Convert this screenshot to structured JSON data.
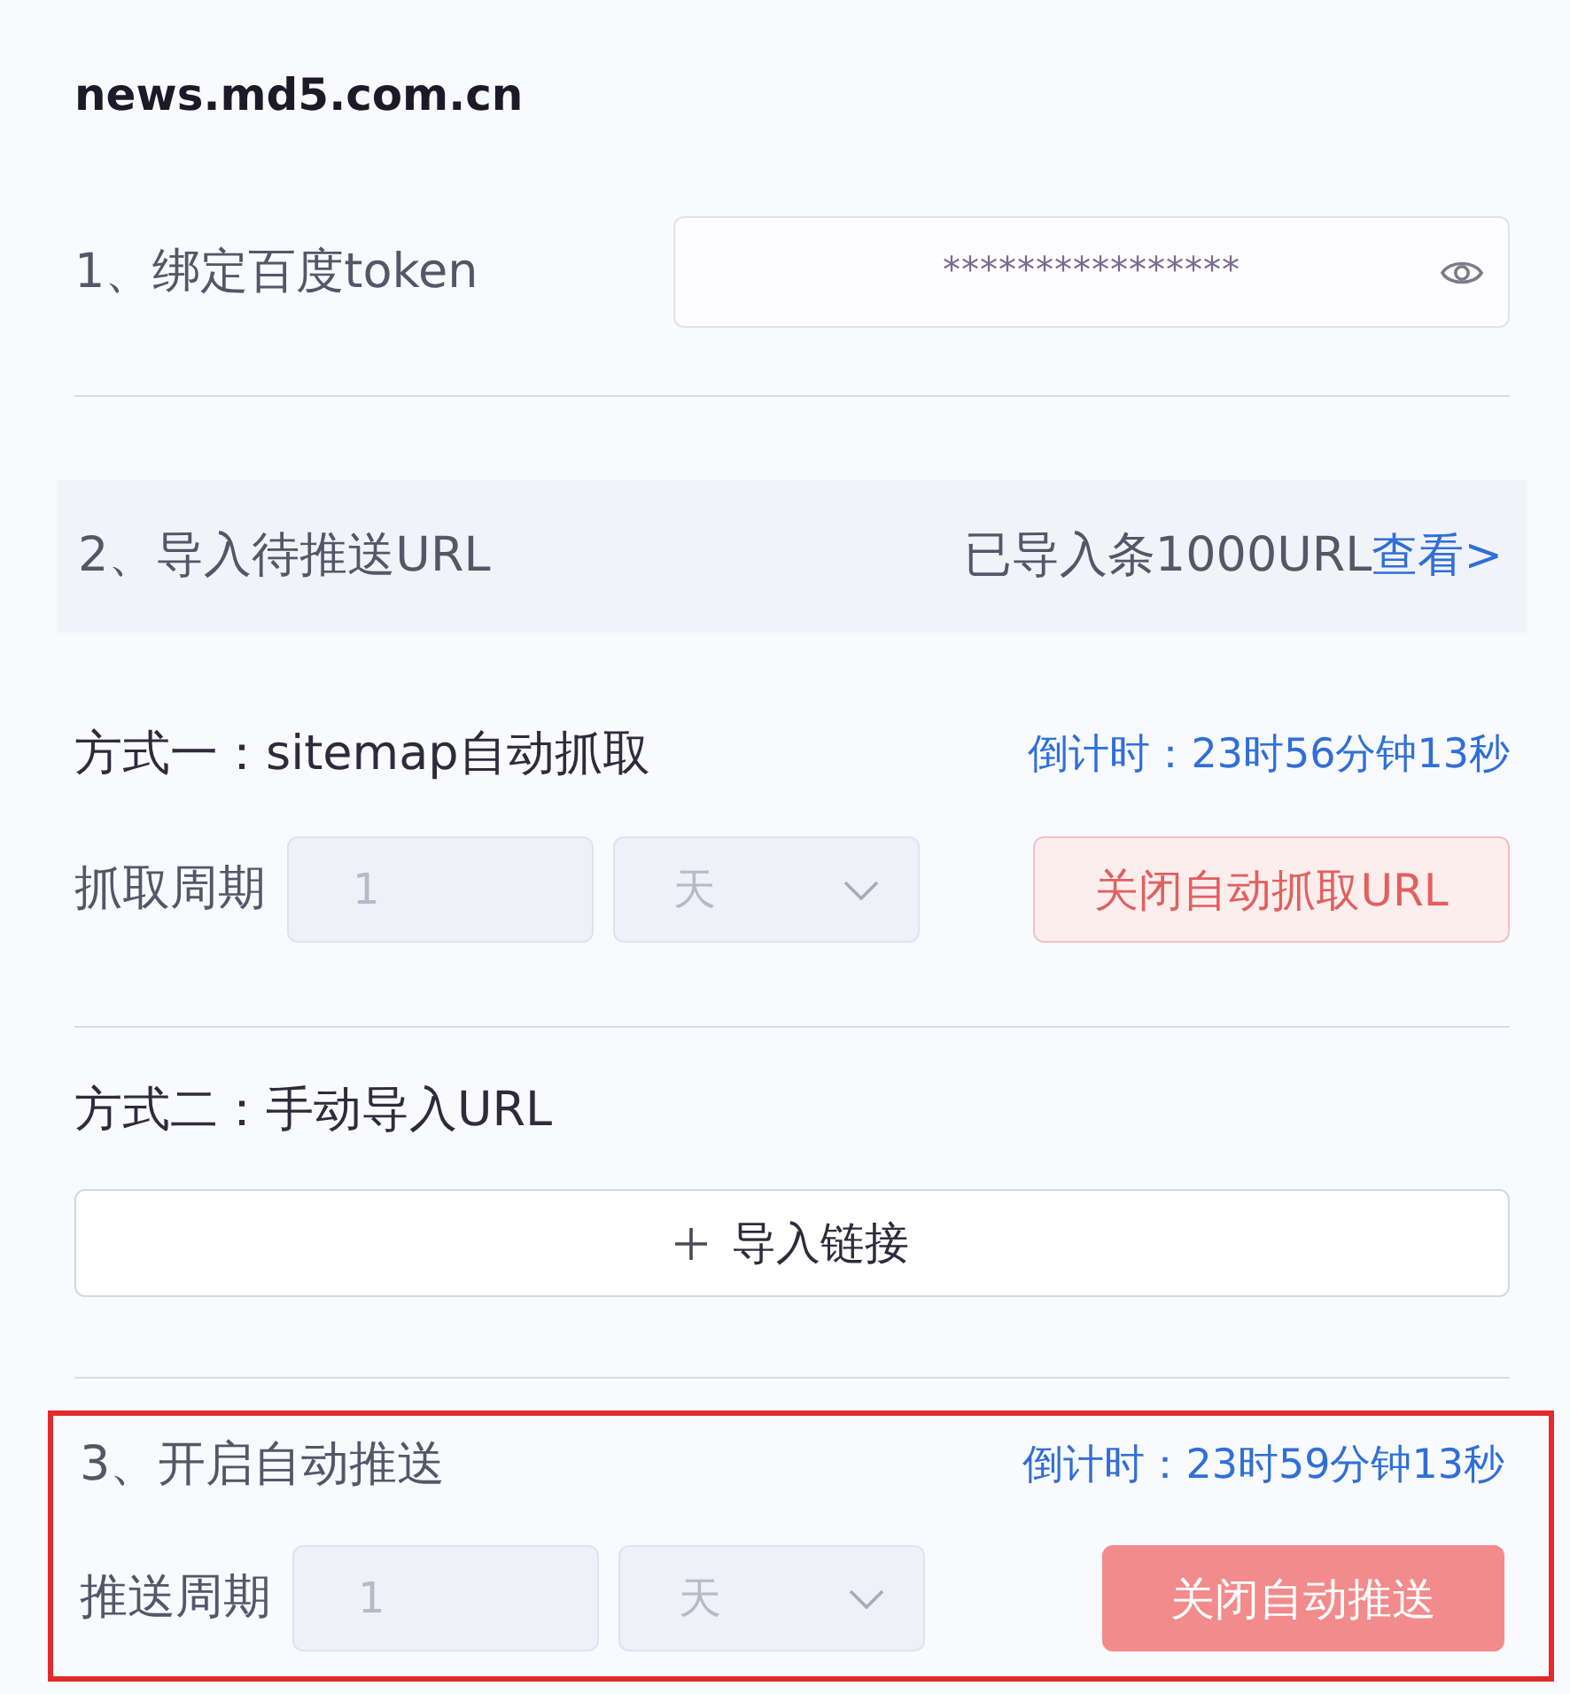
{
  "site_title": "news.md5.com.cn",
  "token": {
    "label": "1、绑定百度token",
    "value": "****************"
  },
  "import": {
    "label": "2、导入待推送URL",
    "summary": "已导入条1000URL",
    "link": "查看>"
  },
  "sitemap": {
    "title": "方式一：sitemap自动抓取",
    "countdown": "倒计时：23时56分钟13秒",
    "period_label": "抓取周期",
    "period_value": "1",
    "period_unit": "天",
    "disabled": true,
    "button": {
      "label": "关闭自动抓取URL",
      "kind": "plain"
    }
  },
  "manual": {
    "title": "方式二：手动导入URL",
    "button": "导入链接"
  },
  "push": {
    "highlighted": true,
    "title": "3、开启自动推送",
    "countdown": "倒计时：23时59分钟13秒",
    "period_label": "推送周期",
    "period_value": "1",
    "period_unit": "天",
    "disabled": true,
    "button": {
      "label": "关闭自动推送",
      "kind": "solid"
    }
  }
}
